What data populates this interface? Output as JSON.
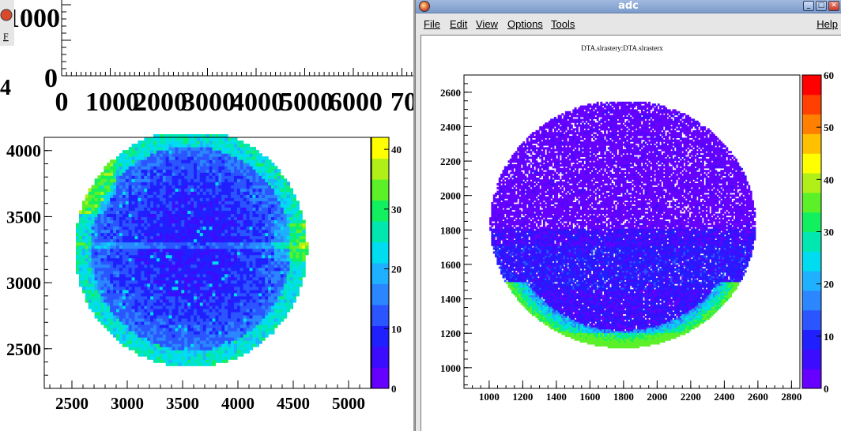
{
  "right_window": {
    "title": "adc",
    "menu": {
      "file": "File",
      "edit": "Edit",
      "view": "View",
      "options": "Options",
      "tools": "Tools",
      "help": "Help"
    },
    "window_buttons": {
      "minimize": "_",
      "maximize": "□",
      "close": "✕"
    }
  },
  "left_window": {
    "menu_fragment": "F"
  },
  "colors": {
    "palette": [
      "#6600ff",
      "#3c0cff",
      "#2020ff",
      "#2a55ff",
      "#2b86ff",
      "#1fb0ff",
      "#00dcf0",
      "#00e8b0",
      "#12f060",
      "#5cf028",
      "#b0f018",
      "#ffff00",
      "#ffc000",
      "#ff8000",
      "#ff4000",
      "#ff0000"
    ],
    "frame": "#000000",
    "pad_background": "#ffffff"
  },
  "chart_data": [
    {
      "type": "heatmap",
      "title": "",
      "xlabel": "",
      "ylabel": "",
      "x_ticks": [
        "0",
        "1000",
        "2000",
        "3000",
        "4000",
        "5000",
        "6000",
        "70"
      ],
      "y_ticks": [
        "1000",
        "0"
      ],
      "y_fragment": "4",
      "note": "partially visible empty axes pad in left window"
    },
    {
      "type": "heatmap",
      "title": "",
      "xlim": [
        2250,
        5200
      ],
      "ylim": [
        2200,
        4100
      ],
      "x_ticks": [
        "2500",
        "3000",
        "3500",
        "4000",
        "4500",
        "5000"
      ],
      "y_ticks": [
        "4000",
        "3500",
        "3000",
        "2500"
      ],
      "y_tick_text": [
        "4000",
        "3500",
        "3000",
        "2500"
      ],
      "z_range": [
        0,
        42
      ],
      "z_ticks": [
        "0",
        "10",
        "20",
        "30",
        "40"
      ],
      "shape": "clipped circle, center (3550,3260), radius 1080, clipped at y=4100, ring brighter at edge, horizontal streak at y=3270"
    },
    {
      "type": "heatmap",
      "title": "DTA.slrastery:DTA.slrasterx",
      "xlim": [
        850,
        2850
      ],
      "ylim": [
        880,
        2700
      ],
      "x_ticks": [
        "1000",
        "1200",
        "1400",
        "1600",
        "1800",
        "2000",
        "2200",
        "2400",
        "2600",
        "2800"
      ],
      "y_ticks": [
        "1000",
        "1200",
        "1400",
        "1600",
        "1800",
        "2000",
        "2200",
        "2400",
        "2600"
      ],
      "z_range": [
        0,
        60
      ],
      "z_ticks": [
        "0",
        "10",
        "20",
        "30",
        "40",
        "50",
        "60"
      ],
      "shape": "ellipse center (1790,1800), rx 790, ry 720, bright crescent near bottom edge y~1150, sparse above y=1800"
    }
  ]
}
